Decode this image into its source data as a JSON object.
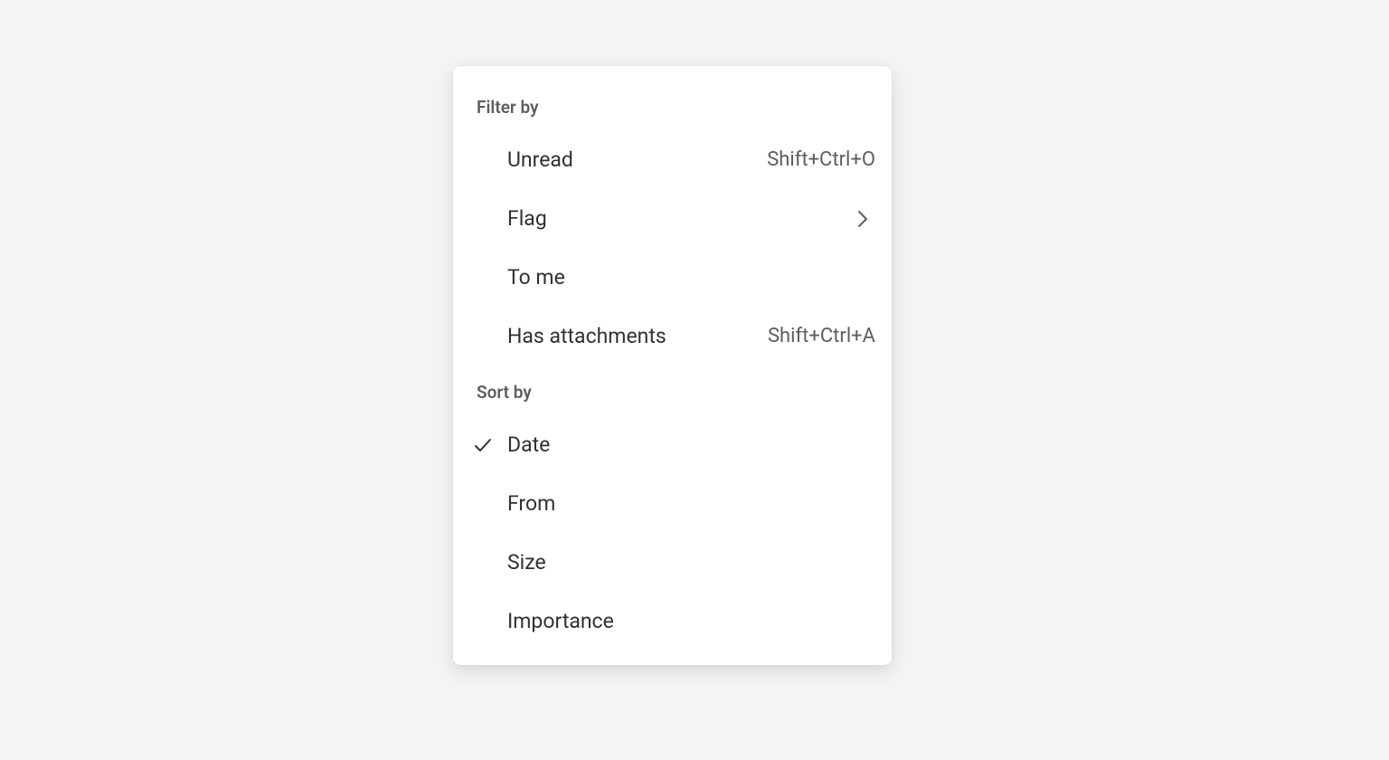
{
  "menu": {
    "filter_header": "Filter by",
    "filter_items": [
      {
        "label": "Unread",
        "shortcut": "Shift+Ctrl+O",
        "submenu": false,
        "checked": false
      },
      {
        "label": "Flag",
        "shortcut": "",
        "submenu": true,
        "checked": false
      },
      {
        "label": "To me",
        "shortcut": "",
        "submenu": false,
        "checked": false
      },
      {
        "label": "Has attachments",
        "shortcut": "Shift+Ctrl+A",
        "submenu": false,
        "checked": false
      }
    ],
    "sort_header": "Sort by",
    "sort_items": [
      {
        "label": "Date",
        "checked": true
      },
      {
        "label": "From",
        "checked": false
      },
      {
        "label": "Size",
        "checked": false
      },
      {
        "label": "Importance",
        "checked": false
      }
    ]
  }
}
